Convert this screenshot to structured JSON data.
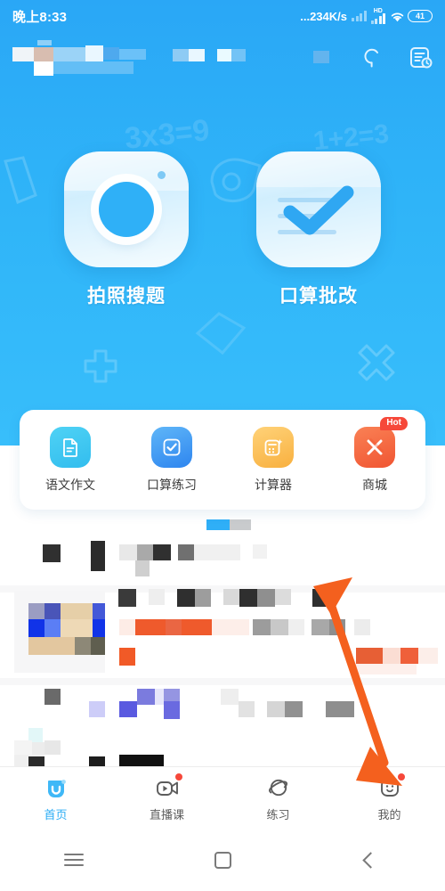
{
  "status_bar": {
    "time": "晚上8:33",
    "network_speed": "...234K/s",
    "hd_label": "HD",
    "battery": "41",
    "wifi_icon": "wifi-icon",
    "signal_icon": "signal-bars-icon"
  },
  "app_bar": {
    "title_redacted": "[mosaic]",
    "search_icon": "search-icon",
    "history_icon": "history-document-icon"
  },
  "hero": {
    "watermarks": [
      "3x3=9",
      "1+2=3"
    ],
    "entries": [
      {
        "label": "拍照搜题",
        "icon": "camera-icon"
      },
      {
        "label": "口算批改",
        "icon": "check-mark-icon"
      }
    ]
  },
  "quick_actions": [
    {
      "label": "语文作文",
      "icon": "document-icon",
      "color": "#3CC6F2",
      "badge": ""
    },
    {
      "label": "口算练习",
      "icon": "checkbox-icon",
      "color": "#3E9BF5",
      "badge": ""
    },
    {
      "label": "计算器",
      "icon": "calculator-icon",
      "color": "#FBBF55",
      "badge": ""
    },
    {
      "label": "商城",
      "icon": "shop-icon",
      "color": "#F56A43",
      "badge": "Hot"
    }
  ],
  "tab_bar": {
    "tabs": [
      {
        "label": "首页",
        "icon": "home-smiley-icon",
        "active": true,
        "badge": false
      },
      {
        "label": "直播课",
        "icon": "video-camera-icon",
        "active": false,
        "badge": true
      },
      {
        "label": "练习",
        "icon": "planet-icon",
        "active": false,
        "badge": false
      },
      {
        "label": "我的",
        "icon": "profile-smiley-icon",
        "active": false,
        "badge": true
      }
    ]
  },
  "system_nav": {
    "recents_icon": "menu-lines-icon",
    "home_icon": "square-home-icon",
    "back_icon": "back-chevron-icon"
  },
  "annotation": {
    "arrow_icon": "orange-arrow-icon",
    "arrow_color": "#F4601E",
    "points_to": "我的"
  },
  "colors": {
    "hero_blue": "#2FB0F7",
    "accent_blue": "#2BADF5",
    "badge_red": "#F6483A",
    "arrow_orange": "#F4601E"
  }
}
